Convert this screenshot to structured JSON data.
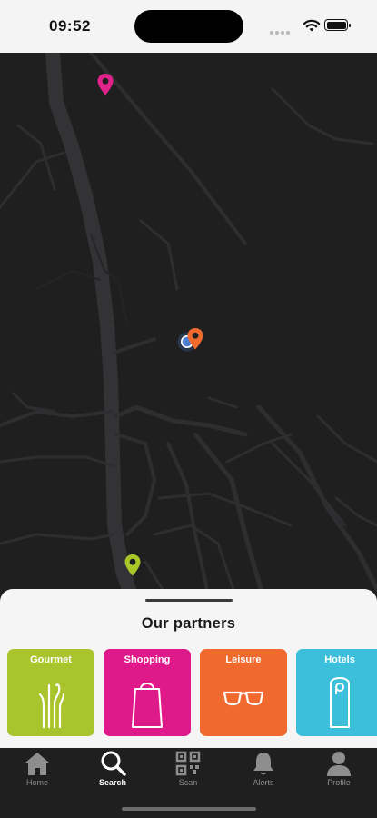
{
  "status_bar": {
    "time": "09:52"
  },
  "map": {
    "pin_colors": {
      "magenta": "#e0238a",
      "orange": "#ef6a2c",
      "lime": "#aac729",
      "user": "#4a7fd4"
    }
  },
  "sheet": {
    "title": "Our partners",
    "categories": [
      {
        "label": "Gourmet",
        "color": "#a9c42d",
        "icon": "cutlery-icon"
      },
      {
        "label": "Shopping",
        "color": "#e0198a",
        "icon": "shopping-bag-icon"
      },
      {
        "label": "Leisure",
        "color": "#f06a30",
        "icon": "glasses-icon"
      },
      {
        "label": "Hotels",
        "color": "#3cbfda",
        "icon": "door-hanger-icon"
      }
    ]
  },
  "tabbar": {
    "items": [
      {
        "label": "Home",
        "icon": "home-icon",
        "active": false
      },
      {
        "label": "Search",
        "icon": "search-icon",
        "active": true
      },
      {
        "label": "Scan",
        "icon": "qr-code-icon",
        "active": false
      },
      {
        "label": "Alerts",
        "icon": "bell-icon",
        "active": false
      },
      {
        "label": "Profile",
        "icon": "profile-icon",
        "active": false
      }
    ]
  }
}
